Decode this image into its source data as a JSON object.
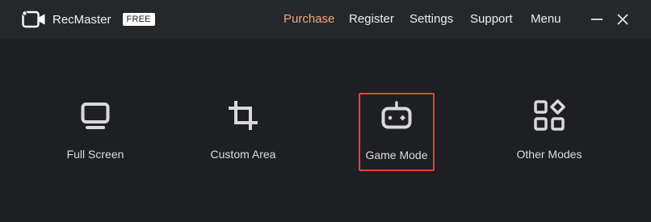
{
  "app": {
    "name": "RecMaster",
    "badge": "FREE"
  },
  "menu": {
    "purchase": "Purchase",
    "register": "Register",
    "settings": "Settings",
    "support": "Support",
    "menu": "Menu"
  },
  "colors": {
    "background": "#1e1f22",
    "titlebar": "#26272b",
    "accent": "#f4a57a",
    "selection": "#e0453d"
  },
  "modes": [
    {
      "label": "Full Screen",
      "icon": "monitor-icon"
    },
    {
      "label": "Custom Area",
      "icon": "crop-icon"
    },
    {
      "label": "Game Mode",
      "icon": "gamepad-icon",
      "selected": true
    },
    {
      "label": "Other Modes",
      "icon": "grid-icon"
    }
  ]
}
